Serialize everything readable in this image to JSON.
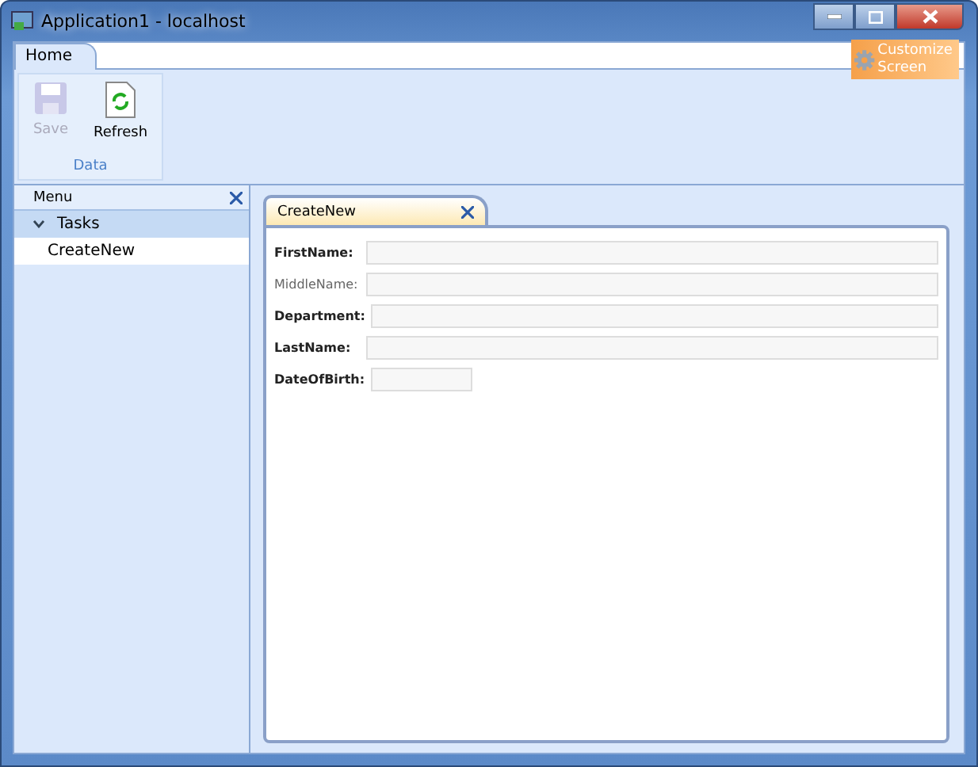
{
  "window": {
    "title": "Application1 - localhost"
  },
  "ribbon": {
    "tabs": [
      {
        "label": "Home",
        "selected": true
      }
    ],
    "groups": [
      {
        "label": "Data",
        "buttons": [
          {
            "label": "Save",
            "disabled": true,
            "kind": "save"
          },
          {
            "label": "Refresh",
            "disabled": false,
            "kind": "refresh"
          }
        ]
      }
    ],
    "customize": {
      "label": "Customize Screen"
    }
  },
  "menu": {
    "title": "Menu",
    "groups": [
      {
        "label": "Tasks",
        "expanded": true,
        "items": [
          {
            "label": "CreateNew",
            "selected": true
          }
        ]
      }
    ]
  },
  "tabs": [
    {
      "label": "CreateNew",
      "selected": true
    }
  ],
  "form": {
    "fields": [
      {
        "label": "FirstName:",
        "required": true,
        "kind": "text"
      },
      {
        "label": "MiddleName:",
        "required": false,
        "kind": "text"
      },
      {
        "label": "Department:",
        "required": true,
        "kind": "text"
      },
      {
        "label": "LastName:",
        "required": true,
        "kind": "text"
      },
      {
        "label": "DateOfBirth:",
        "required": true,
        "kind": "date"
      }
    ]
  }
}
